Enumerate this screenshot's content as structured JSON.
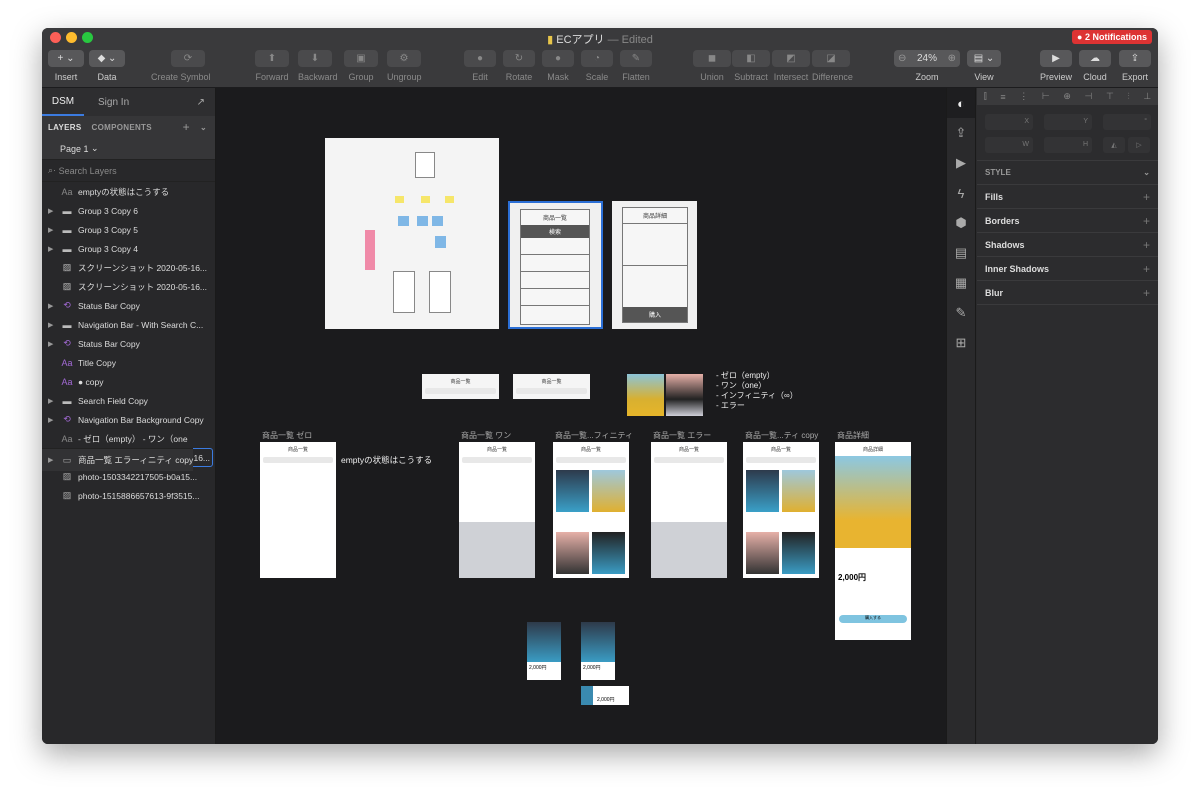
{
  "window": {
    "title": "ECアプリ",
    "edited": "— Edited",
    "notifications": "2 Notifications"
  },
  "toolbar": {
    "insert": "Insert",
    "data": "Data",
    "create_symbol": "Create Symbol",
    "forward": "Forward",
    "backward": "Backward",
    "group": "Group",
    "ungroup": "Ungroup",
    "edit": "Edit",
    "rotate": "Rotate",
    "mask": "Mask",
    "scale": "Scale",
    "flatten": "Flatten",
    "union": "Union",
    "subtract": "Subtract",
    "intersect": "Intersect",
    "difference": "Difference",
    "zoom_value": "24%",
    "zoom": "Zoom",
    "view": "View",
    "preview": "Preview",
    "cloud": "Cloud",
    "export": "Export"
  },
  "left": {
    "dsm": "DSM",
    "sign_in": "Sign In",
    "tab_layers": "LAYERS",
    "tab_components": "COMPONENTS",
    "page": "Page 1",
    "search_placeholder": "Search Layers",
    "layers": [
      {
        "label": "emptyの状態はこうする",
        "type": "text"
      },
      {
        "label": "Group 3 Copy 6",
        "type": "folder"
      },
      {
        "label": "Group 3 Copy 5",
        "type": "folder"
      },
      {
        "label": "Group 3 Copy 4",
        "type": "folder"
      },
      {
        "label": "スクリーンショット 2020-05-16...",
        "type": "image"
      },
      {
        "label": "スクリーンショット 2020-05-16...",
        "type": "image"
      },
      {
        "label": "Status Bar Copy",
        "type": "symbol"
      },
      {
        "label": "Navigation Bar - With Search C...",
        "type": "folder"
      },
      {
        "label": "Status Bar Copy",
        "type": "symbol"
      },
      {
        "label": "Title Copy",
        "type": "text-style"
      },
      {
        "label": "● copy",
        "type": "text-style"
      },
      {
        "label": "Search Field Copy",
        "type": "folder"
      },
      {
        "label": "Navigation Bar Background Copy",
        "type": "symbol"
      },
      {
        "label": "- ゼロ（empty） - ワン（one",
        "type": "text"
      }
    ],
    "artboards": [
      "商品詳細",
      "商品一覧 インフィニティ copy",
      "商品一覧 インフィニティ",
      "商品一覧 ワン",
      "商品一覧 ゼロ",
      "商品一覧 エラー"
    ],
    "bottom_layers": [
      "スクリーンショット 2020-05-16...",
      "photo-1503342217505-b0a15...",
      "photo-1515886657613-9f3515..."
    ]
  },
  "canvas": {
    "wire_list_title": "商品一覧",
    "wire_list_search": "検索",
    "wire_detail_title": "商品詳細",
    "wire_detail_buy": "購入",
    "list_notes": [
      "- ゼロ（empty）",
      "- ワン（one）",
      "- インフィニティ（∞）",
      "- エラー"
    ],
    "artboard_labels": [
      "商品一覧 ゼロ",
      "商品一覧 ワン",
      "商品一覧...フィニティ",
      "商品一覧 エラー",
      "商品一覧...ティ copy",
      "商品詳細"
    ],
    "empty_note": "emptyの状態はこうする",
    "screen_title": "商品一覧",
    "detail_screen_title": "商品詳細",
    "price": "2,000円",
    "buy": "購入する"
  },
  "inspector": {
    "x": "X",
    "y": "Y",
    "deg": "°",
    "w": "W",
    "h": "H",
    "style": "STYLE",
    "rows": [
      "Fills",
      "Borders",
      "Shadows",
      "Inner Shadows",
      "Blur"
    ]
  }
}
